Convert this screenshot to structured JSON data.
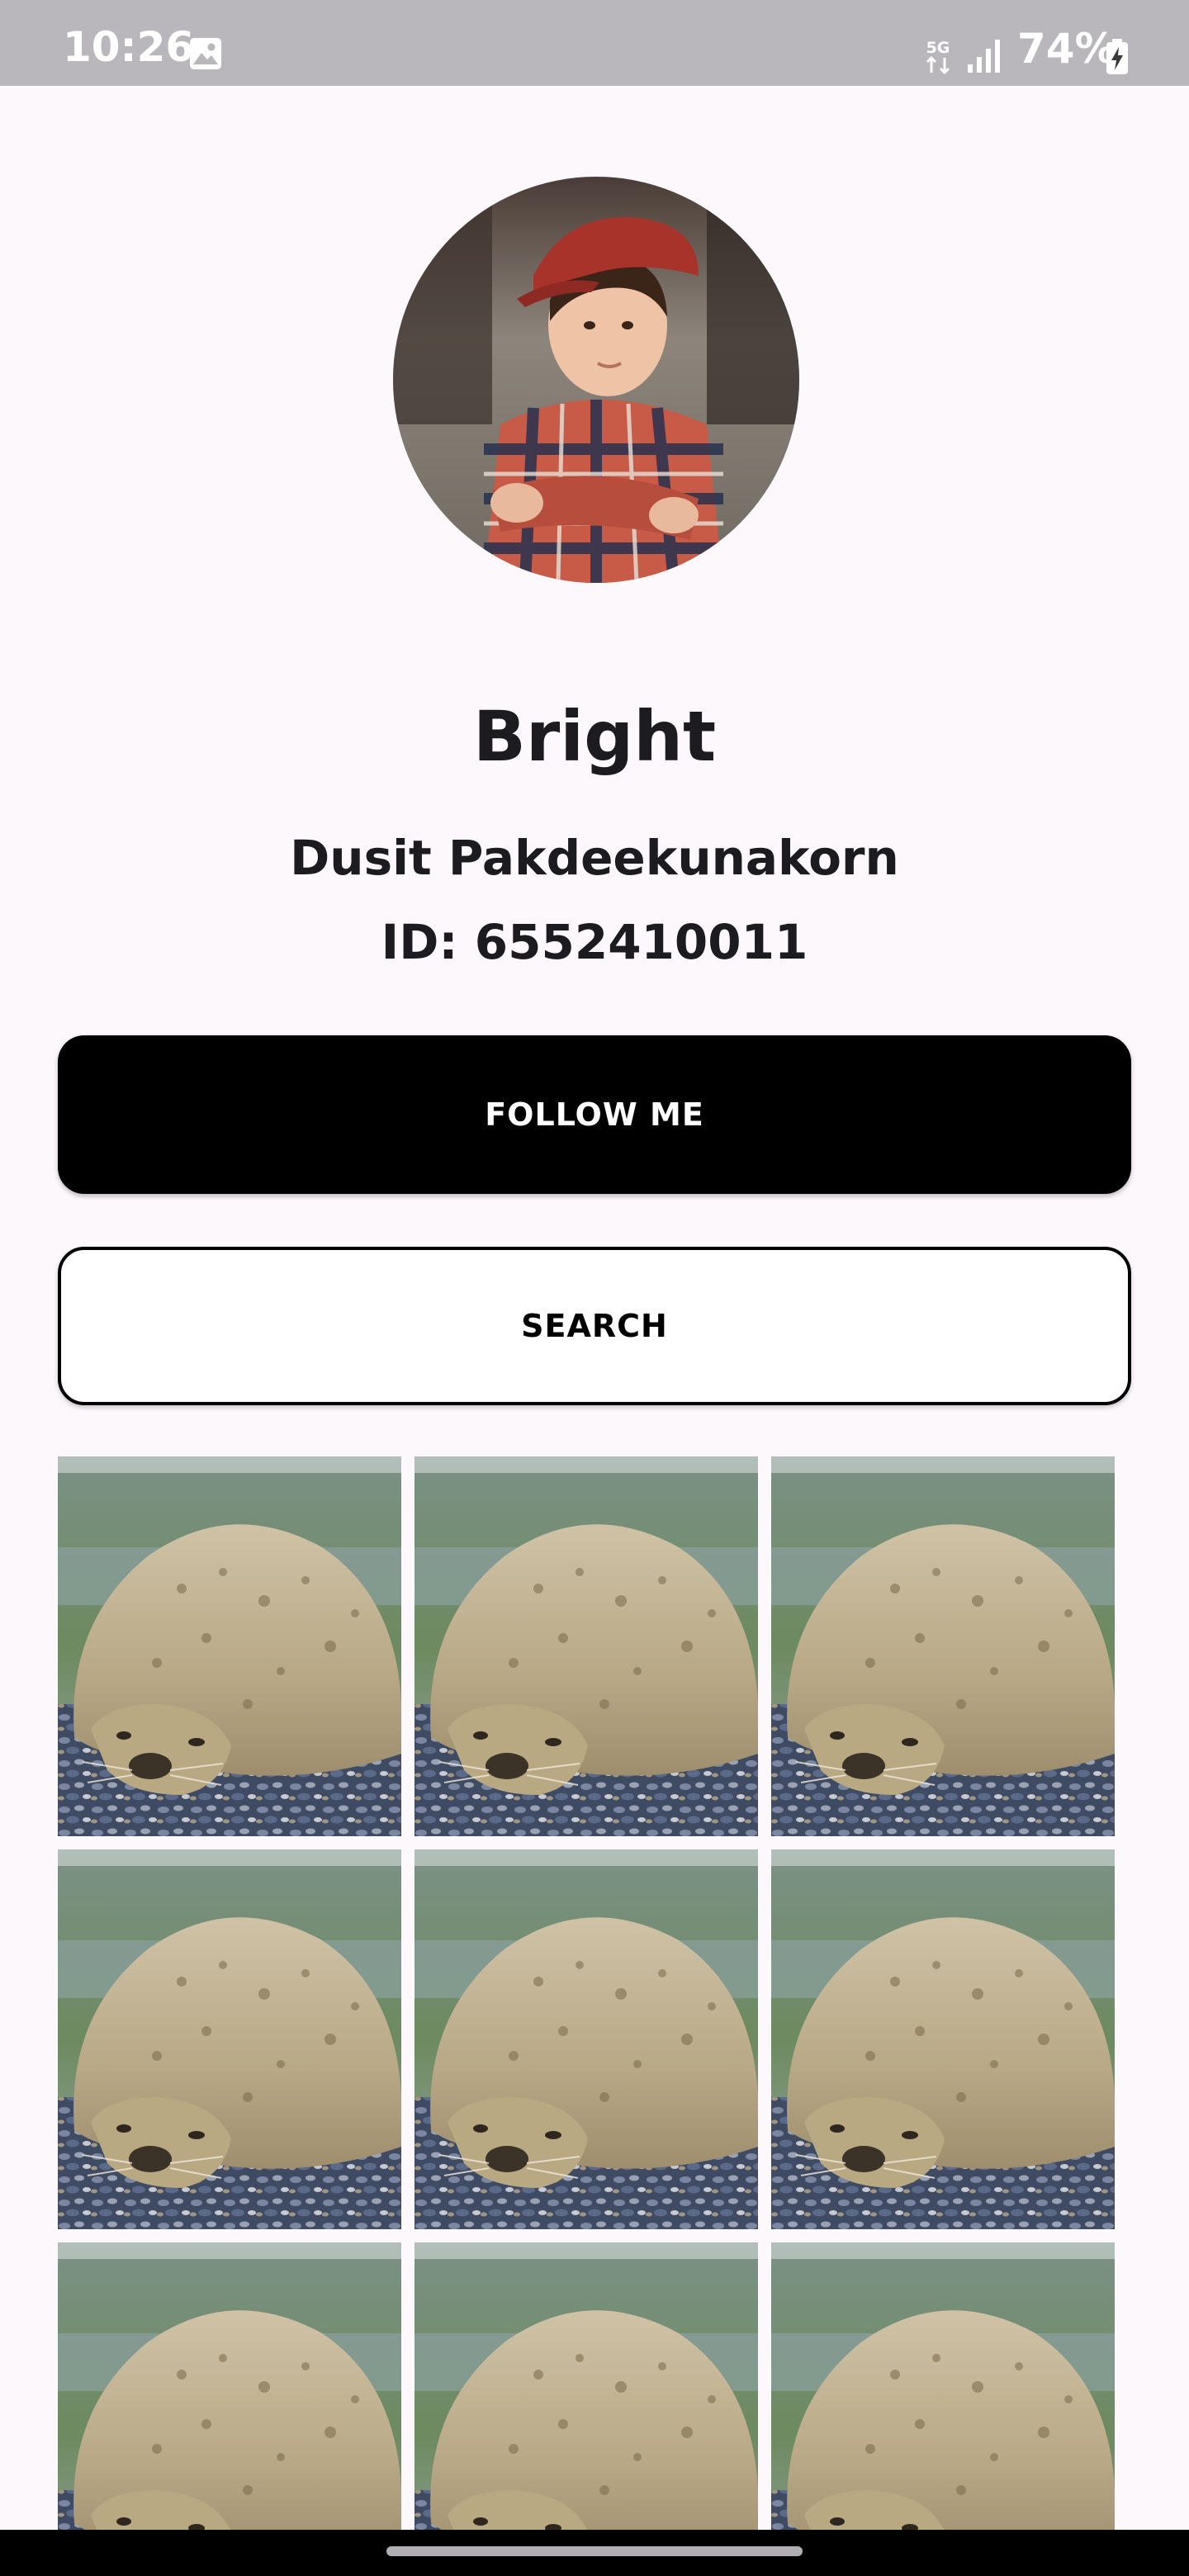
{
  "status_bar": {
    "time": "10:26",
    "network": "5G",
    "battery": "74%",
    "icons": [
      "gallery-icon",
      "signal-icon",
      "battery-charging-icon"
    ]
  },
  "profile": {
    "nickname": "Bright",
    "full_name": "Dusit Pakdeekunakorn",
    "student_id": "ID: 6552410011",
    "avatar_icon": "avatar-photo"
  },
  "buttons": {
    "follow": "FOLLOW ME",
    "search": "SEARCH"
  },
  "gallery": {
    "photo_icon": "seal-photo",
    "tiles": [
      "seal-photo",
      "seal-photo",
      "seal-photo",
      "seal-photo",
      "seal-photo",
      "seal-photo",
      "seal-photo",
      "seal-photo",
      "seal-photo"
    ]
  },
  "colors": {
    "background": "#fdf8fc",
    "status_bar": "#b9b6bc",
    "primary_button": "#000000",
    "text": "#1c1b1f"
  }
}
